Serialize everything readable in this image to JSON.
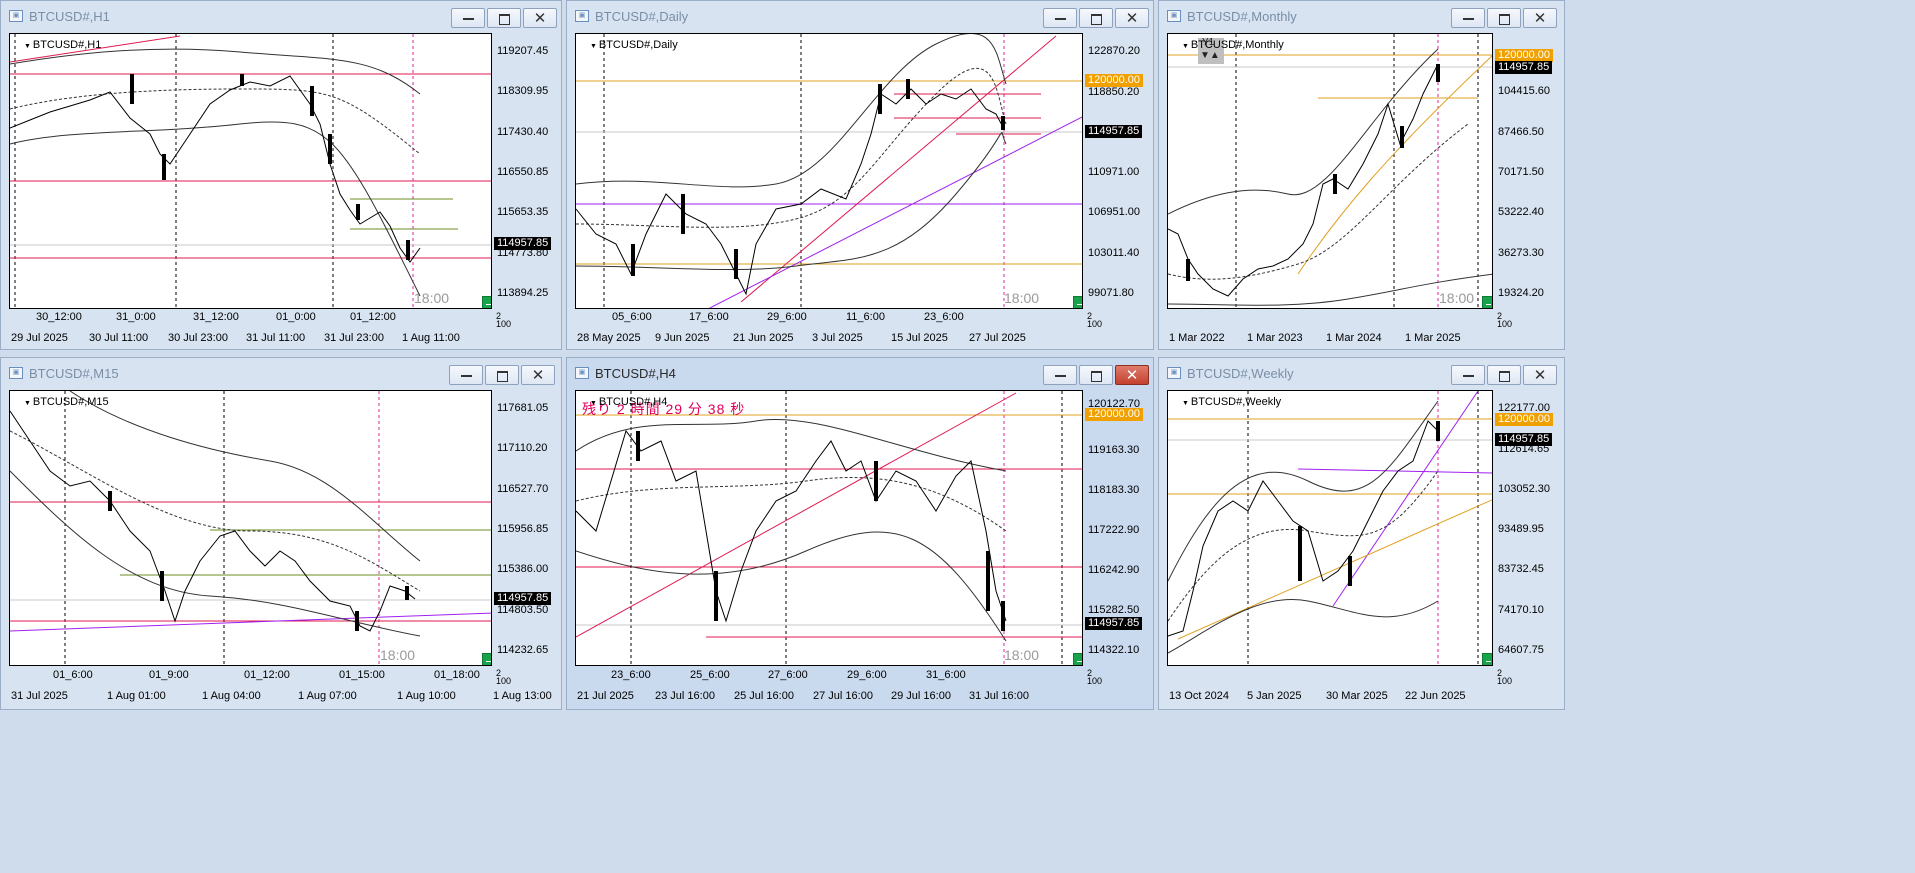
{
  "colors": {
    "red_line": "#e0194f",
    "gold_line": "#e0a020",
    "purple_line": "#a020f0",
    "pink_vline": "#e0259a",
    "bb_line": "#333333",
    "price_box_bg": "#000000",
    "target_box_bg": "#f0a000",
    "countdown": "#e0005a",
    "status_green": "#16a34a"
  },
  "current_price": "114957.85",
  "target_price": "120000.00",
  "session_time": "18:00",
  "panel_corner_label": "2",
  "panel_corner_label2": "100",
  "windows": [
    {
      "title": "BTCUSD#,H1",
      "symbol": "BTCUSD#,H1",
      "prices": [
        "119207.45",
        "118309.95",
        "117430.40",
        "116550.85",
        "115653.35",
        "114773.80",
        "113894.25"
      ],
      "top_ticks": [
        "30_12:00",
        "31_0:00",
        "31_12:00",
        "01_0:00",
        "01_12:00"
      ],
      "dates": [
        "29 Jul 2025",
        "30 Jul 11:00",
        "30 Jul 23:00",
        "31 Jul 11:00",
        "31 Jul 23:00",
        "1 Aug 11:00"
      ]
    },
    {
      "title": "BTCUSD#,Daily",
      "symbol": "BTCUSD#,Daily",
      "prices": [
        "122870.20",
        "118850.20",
        "110971.00",
        "106951.00",
        "103011.40",
        "99071.80"
      ],
      "top_ticks": [
        "05_6:00",
        "17_6:00",
        "29_6:00",
        "11_6:00",
        "23_6:00"
      ],
      "dates": [
        "28 May 2025",
        "9 Jun 2025",
        "21 Jun 2025",
        "3 Jul 2025",
        "15 Jul 2025",
        "27 Jul 2025"
      ]
    },
    {
      "title": "BTCUSD#,Monthly",
      "symbol": "BTCUSD#,Monthly",
      "prices": [
        "104415.60",
        "87466.50",
        "70171.50",
        "53222.40",
        "36273.30",
        "19324.20"
      ],
      "dates": [
        "1 Mar 2022",
        "1 Mar 2023",
        "1 Mar 2024",
        "1 Mar 2025"
      ],
      "y_control": "Y1"
    },
    {
      "title": "BTCUSD#,M15",
      "symbol": "BTCUSD#,M15",
      "prices": [
        "117681.05",
        "117110.20",
        "116527.70",
        "115956.85",
        "115386.00",
        "114803.50",
        "114232.65"
      ],
      "top_ticks": [
        "01_6:00",
        "01_9:00",
        "01_12:00",
        "01_15:00",
        "01_18:00"
      ],
      "dates": [
        "31 Jul 2025",
        "1 Aug 01:00",
        "1 Aug 04:00",
        "1 Aug 07:00",
        "1 Aug 10:00",
        "1 Aug 13:00"
      ]
    },
    {
      "title": "BTCUSD#,H4",
      "symbol": "BTCUSD#,H4",
      "countdown": "残り 2 時間 29 分 38 秒",
      "prices": [
        "120122.70",
        "119163.30",
        "118183.30",
        "117222.90",
        "116242.90",
        "115282.50",
        "114322.10"
      ],
      "top_ticks": [
        "23_6:00",
        "25_6:00",
        "27_6:00",
        "29_6:00",
        "31_6:00"
      ],
      "dates": [
        "21 Jul 2025",
        "23 Jul 16:00",
        "25 Jul 16:00",
        "27 Jul 16:00",
        "29 Jul 16:00",
        "31 Jul 16:00"
      ]
    },
    {
      "title": "BTCUSD#,Weekly",
      "symbol": "BTCUSD#,Weekly",
      "prices": [
        "122177.00",
        "112614.65",
        "103052.30",
        "93489.95",
        "83732.45",
        "74170.10",
        "64607.75"
      ],
      "dates": [
        "13 Oct 2024",
        "5 Jan 2025",
        "30 Mar 2025",
        "22 Jun 2025"
      ]
    }
  ]
}
